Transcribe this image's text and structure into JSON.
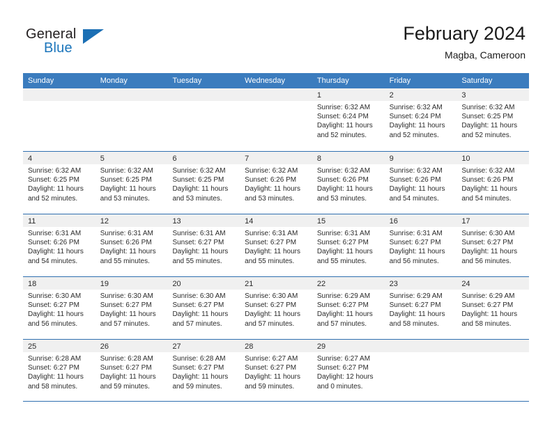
{
  "brand": {
    "name_top": "General",
    "name_bottom": "Blue",
    "triangle_color": "#1b6fb4",
    "blue_color": "#1b75bb"
  },
  "header": {
    "title": "February 2024",
    "subtitle": "Magba, Cameroon"
  },
  "theme": {
    "header_bg": "#3b7cbe",
    "row_divider": "#2f6fb0",
    "day_head_bg": "#f0f0f0",
    "text": "#2b2b2b"
  },
  "weekdays": [
    "Sunday",
    "Monday",
    "Tuesday",
    "Wednesday",
    "Thursday",
    "Friday",
    "Saturday"
  ],
  "weeks": [
    [
      {
        "day": "",
        "lines": []
      },
      {
        "day": "",
        "lines": []
      },
      {
        "day": "",
        "lines": []
      },
      {
        "day": "",
        "lines": []
      },
      {
        "day": "1",
        "lines": [
          "Sunrise: 6:32 AM",
          "Sunset: 6:24 PM",
          "Daylight: 11 hours",
          "and 52 minutes."
        ]
      },
      {
        "day": "2",
        "lines": [
          "Sunrise: 6:32 AM",
          "Sunset: 6:24 PM",
          "Daylight: 11 hours",
          "and 52 minutes."
        ]
      },
      {
        "day": "3",
        "lines": [
          "Sunrise: 6:32 AM",
          "Sunset: 6:25 PM",
          "Daylight: 11 hours",
          "and 52 minutes."
        ]
      }
    ],
    [
      {
        "day": "4",
        "lines": [
          "Sunrise: 6:32 AM",
          "Sunset: 6:25 PM",
          "Daylight: 11 hours",
          "and 52 minutes."
        ]
      },
      {
        "day": "5",
        "lines": [
          "Sunrise: 6:32 AM",
          "Sunset: 6:25 PM",
          "Daylight: 11 hours",
          "and 53 minutes."
        ]
      },
      {
        "day": "6",
        "lines": [
          "Sunrise: 6:32 AM",
          "Sunset: 6:25 PM",
          "Daylight: 11 hours",
          "and 53 minutes."
        ]
      },
      {
        "day": "7",
        "lines": [
          "Sunrise: 6:32 AM",
          "Sunset: 6:26 PM",
          "Daylight: 11 hours",
          "and 53 minutes."
        ]
      },
      {
        "day": "8",
        "lines": [
          "Sunrise: 6:32 AM",
          "Sunset: 6:26 PM",
          "Daylight: 11 hours",
          "and 53 minutes."
        ]
      },
      {
        "day": "9",
        "lines": [
          "Sunrise: 6:32 AM",
          "Sunset: 6:26 PM",
          "Daylight: 11 hours",
          "and 54 minutes."
        ]
      },
      {
        "day": "10",
        "lines": [
          "Sunrise: 6:32 AM",
          "Sunset: 6:26 PM",
          "Daylight: 11 hours",
          "and 54 minutes."
        ]
      }
    ],
    [
      {
        "day": "11",
        "lines": [
          "Sunrise: 6:31 AM",
          "Sunset: 6:26 PM",
          "Daylight: 11 hours",
          "and 54 minutes."
        ]
      },
      {
        "day": "12",
        "lines": [
          "Sunrise: 6:31 AM",
          "Sunset: 6:26 PM",
          "Daylight: 11 hours",
          "and 55 minutes."
        ]
      },
      {
        "day": "13",
        "lines": [
          "Sunrise: 6:31 AM",
          "Sunset: 6:27 PM",
          "Daylight: 11 hours",
          "and 55 minutes."
        ]
      },
      {
        "day": "14",
        "lines": [
          "Sunrise: 6:31 AM",
          "Sunset: 6:27 PM",
          "Daylight: 11 hours",
          "and 55 minutes."
        ]
      },
      {
        "day": "15",
        "lines": [
          "Sunrise: 6:31 AM",
          "Sunset: 6:27 PM",
          "Daylight: 11 hours",
          "and 55 minutes."
        ]
      },
      {
        "day": "16",
        "lines": [
          "Sunrise: 6:31 AM",
          "Sunset: 6:27 PM",
          "Daylight: 11 hours",
          "and 56 minutes."
        ]
      },
      {
        "day": "17",
        "lines": [
          "Sunrise: 6:30 AM",
          "Sunset: 6:27 PM",
          "Daylight: 11 hours",
          "and 56 minutes."
        ]
      }
    ],
    [
      {
        "day": "18",
        "lines": [
          "Sunrise: 6:30 AM",
          "Sunset: 6:27 PM",
          "Daylight: 11 hours",
          "and 56 minutes."
        ]
      },
      {
        "day": "19",
        "lines": [
          "Sunrise: 6:30 AM",
          "Sunset: 6:27 PM",
          "Daylight: 11 hours",
          "and 57 minutes."
        ]
      },
      {
        "day": "20",
        "lines": [
          "Sunrise: 6:30 AM",
          "Sunset: 6:27 PM",
          "Daylight: 11 hours",
          "and 57 minutes."
        ]
      },
      {
        "day": "21",
        "lines": [
          "Sunrise: 6:30 AM",
          "Sunset: 6:27 PM",
          "Daylight: 11 hours",
          "and 57 minutes."
        ]
      },
      {
        "day": "22",
        "lines": [
          "Sunrise: 6:29 AM",
          "Sunset: 6:27 PM",
          "Daylight: 11 hours",
          "and 57 minutes."
        ]
      },
      {
        "day": "23",
        "lines": [
          "Sunrise: 6:29 AM",
          "Sunset: 6:27 PM",
          "Daylight: 11 hours",
          "and 58 minutes."
        ]
      },
      {
        "day": "24",
        "lines": [
          "Sunrise: 6:29 AM",
          "Sunset: 6:27 PM",
          "Daylight: 11 hours",
          "and 58 minutes."
        ]
      }
    ],
    [
      {
        "day": "25",
        "lines": [
          "Sunrise: 6:28 AM",
          "Sunset: 6:27 PM",
          "Daylight: 11 hours",
          "and 58 minutes."
        ]
      },
      {
        "day": "26",
        "lines": [
          "Sunrise: 6:28 AM",
          "Sunset: 6:27 PM",
          "Daylight: 11 hours",
          "and 59 minutes."
        ]
      },
      {
        "day": "27",
        "lines": [
          "Sunrise: 6:28 AM",
          "Sunset: 6:27 PM",
          "Daylight: 11 hours",
          "and 59 minutes."
        ]
      },
      {
        "day": "28",
        "lines": [
          "Sunrise: 6:27 AM",
          "Sunset: 6:27 PM",
          "Daylight: 11 hours",
          "and 59 minutes."
        ]
      },
      {
        "day": "29",
        "lines": [
          "Sunrise: 6:27 AM",
          "Sunset: 6:27 PM",
          "Daylight: 12 hours",
          "and 0 minutes."
        ]
      },
      {
        "day": "",
        "lines": []
      },
      {
        "day": "",
        "lines": []
      }
    ]
  ]
}
